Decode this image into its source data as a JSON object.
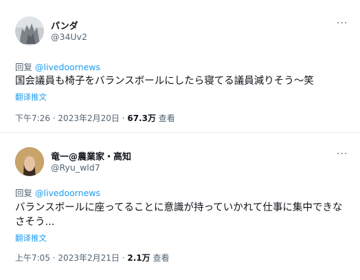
{
  "tweets": [
    {
      "name": "パンダ",
      "handle": "@34Uv2",
      "reply_prefix": "回复",
      "reply_to": "@livedoornews",
      "text": "国会議員も椅子をバランスボールにしたら寝てる議員減りそう〜笑",
      "translate": "翻译推文",
      "time": "下午7:26",
      "date": "2023年2月20日",
      "views_count": "67.3万",
      "views_label": "查看",
      "more_icon": "more-icon"
    },
    {
      "name": "竜一@農業家・高知",
      "handle": "@Ryu_wld7",
      "reply_prefix": "回复",
      "reply_to": "@livedoornews",
      "text": "バランスボールに座ってることに意識が持っていかれて仕事に集中できなさそう...",
      "translate": "翻译推文",
      "time": "上午7:05",
      "date": "2023年2月21日",
      "views_count": "2.1万",
      "views_label": "查看",
      "more_icon": "more-icon"
    }
  ],
  "colors": {
    "link": "#1d9bf0",
    "secondary_text": "#536471",
    "primary_text": "#0f1419"
  }
}
